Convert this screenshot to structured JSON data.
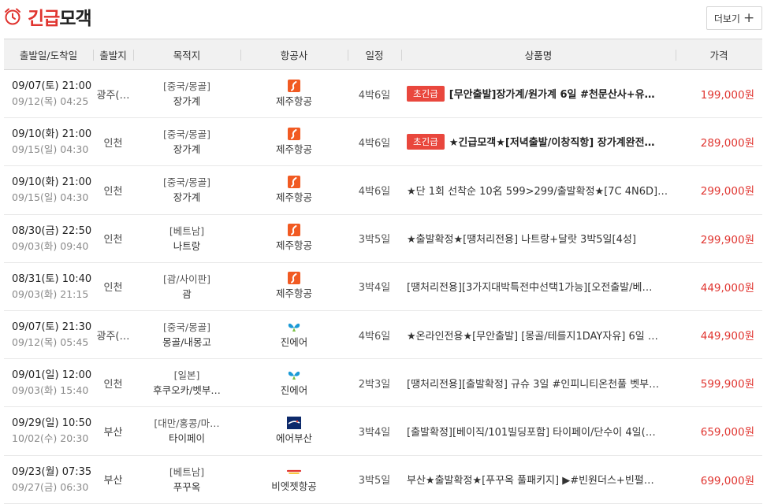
{
  "header": {
    "title_red": "긴급",
    "title_dark": "모객",
    "more_label": "더보기",
    "more_plus": "+"
  },
  "colors": {
    "accent": "#e0342f",
    "badge": "#e9473d",
    "header_bg": "#f1f1f1"
  },
  "columns": [
    "출발일/도착일",
    "출발지",
    "목적지",
    "항공사",
    "일정",
    "상품명",
    "가격"
  ],
  "rows": [
    {
      "dep": "09/07(토) 21:00",
      "arr": "09/12(목) 04:25",
      "city": "광주(…",
      "region": "[중국/몽골]",
      "place": "장가계",
      "airline_logo": "jeju-air-logo",
      "airline": "제주항공",
      "schedule": "4박6일",
      "badge": "초긴급",
      "product": "[무안출발]장가계/원가계 6일 #천문산사+유…",
      "price": "199,000원"
    },
    {
      "dep": "09/10(화) 21:00",
      "arr": "09/15(일) 04:30",
      "city": "인천",
      "region": "[중국/몽골]",
      "place": "장가계",
      "airline_logo": "jeju-air-logo",
      "airline": "제주항공",
      "schedule": "4박6일",
      "badge": "초긴급",
      "product": "★긴급모객★[저녁출발/이창직항] 장가계완전…",
      "price": "289,000원"
    },
    {
      "dep": "09/10(화) 21:00",
      "arr": "09/15(일) 04:30",
      "city": "인천",
      "region": "[중국/몽골]",
      "place": "장가계",
      "airline_logo": "jeju-air-logo",
      "airline": "제주항공",
      "schedule": "4박6일",
      "badge": "",
      "product": "★단 1회 선착순 10名 599>299/출발확정★[7C 4N6D]…",
      "price": "299,000원"
    },
    {
      "dep": "08/30(금) 22:50",
      "arr": "09/03(화) 09:40",
      "city": "인천",
      "region": "[베트남]",
      "place": "나트랑",
      "airline_logo": "jeju-air-logo",
      "airline": "제주항공",
      "schedule": "3박5일",
      "badge": "",
      "product": "★출발확정★[땡처리전용] 나트랑+달랏 3박5일[4성]",
      "price": "299,900원"
    },
    {
      "dep": "08/31(토) 10:40",
      "arr": "09/03(화) 21:15",
      "city": "인천",
      "region": "[괌/사이판]",
      "place": "괌",
      "airline_logo": "jeju-air-logo",
      "airline": "제주항공",
      "schedule": "3박4일",
      "badge": "",
      "product": "[땡처리전용][3가지대박특전中선택1가능][오전출발/베…",
      "price": "449,000원"
    },
    {
      "dep": "09/07(토) 21:30",
      "arr": "09/12(목) 05:45",
      "city": "광주(…",
      "region": "[중국/몽골]",
      "place": "몽골/내몽고",
      "airline_logo": "jin-air-logo",
      "airline": "진에어",
      "schedule": "4박6일",
      "badge": "",
      "product": "★온라인전용★[무안출발] [몽골/테를지1DAY자유] 6일 …",
      "price": "449,900원"
    },
    {
      "dep": "09/01(일) 12:00",
      "arr": "09/03(화) 15:40",
      "city": "인천",
      "region": "[일본]",
      "place": "후쿠오카/벳부…",
      "airline_logo": "jin-air-logo",
      "airline": "진에어",
      "schedule": "2박3일",
      "badge": "",
      "product": "[땡처리전용][출발확정] 규슈 3일 #인피니티온천풀 벳부…",
      "price": "599,900원"
    },
    {
      "dep": "09/29(일) 10:50",
      "arr": "10/02(수) 20:30",
      "city": "부산",
      "region": "[대만/홍콩/마…",
      "place": "타이페이",
      "airline_logo": "air-busan-logo",
      "airline": "에어부산",
      "schedule": "3박4일",
      "badge": "",
      "product": "[출발확정][베이직/101빌딩포함] 타이페이/단수이 4일(…",
      "price": "659,000원"
    },
    {
      "dep": "09/23(월) 07:35",
      "arr": "09/27(금) 06:30",
      "city": "부산",
      "region": "[베트남]",
      "place": "푸꾸옥",
      "airline_logo": "vietjet-logo",
      "airline": "비엣젯항공",
      "schedule": "3박5일",
      "badge": "",
      "product": "부산★출발확정★[푸꾸옥 풀패키지] ▶#빈원더스+빈펄…",
      "price": "699,000원"
    }
  ]
}
